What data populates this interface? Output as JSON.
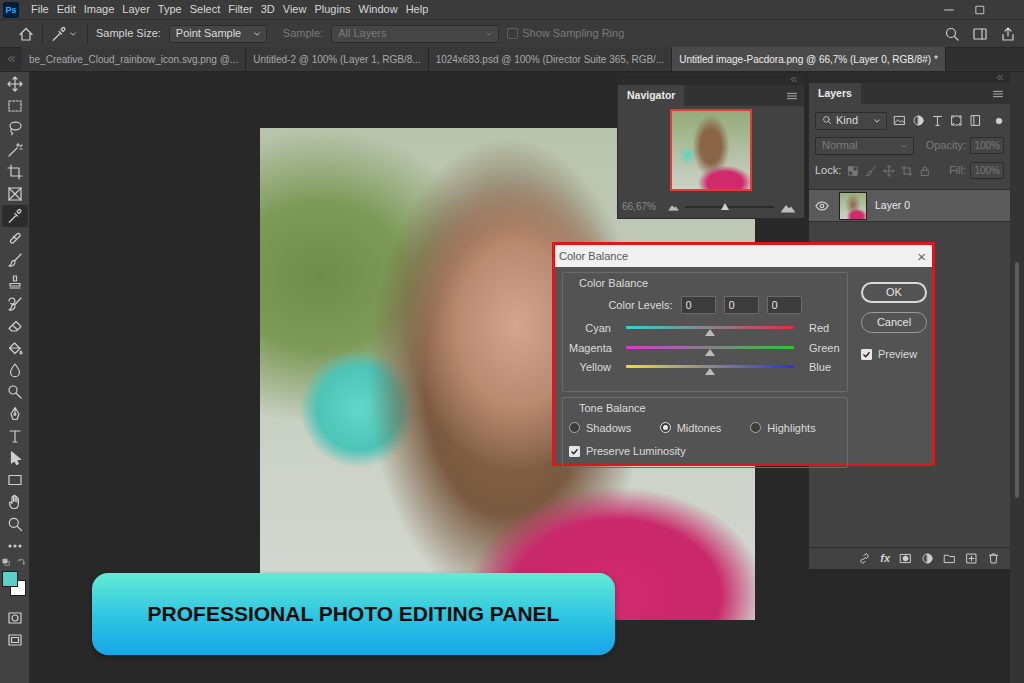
{
  "app": {
    "logo": "Ps"
  },
  "menu": [
    "File",
    "Edit",
    "Image",
    "Layer",
    "Type",
    "Select",
    "Filter",
    "3D",
    "View",
    "Plugins",
    "Window",
    "Help"
  ],
  "options_bar": {
    "sample_size_label": "Sample Size:",
    "sample_size": "Point Sample",
    "sample_label": "Sample:",
    "sample": "All Layers",
    "sample_disabled": true,
    "sampling_ring": {
      "label": "Show Sampling Ring",
      "checked": false,
      "disabled": true
    }
  },
  "tabs": [
    {
      "label": "be_Creative_Cloud_rainbow_icon.svg.png @...",
      "selected": false
    },
    {
      "label": "Untitled-2 @ 100% (Layer 1, RGB/8...",
      "selected": false
    },
    {
      "label": "1024x683.psd @ 100% (Director Suite 365, RGB/...",
      "selected": false
    },
    {
      "label": "Untitled image-Pacdora.png @ 66,7% (Layer 0, RGB/8#) *",
      "selected": true
    }
  ],
  "tools": [
    {
      "selected": false
    },
    {
      "selected": false
    },
    {
      "selected": false
    },
    {
      "selected": false
    },
    {
      "selected": false
    },
    {
      "selected": false
    },
    {
      "selected": true
    },
    {
      "selected": false
    },
    {
      "selected": false
    },
    {
      "selected": false
    },
    {
      "selected": false
    },
    {
      "selected": false
    },
    {
      "selected": false
    },
    {
      "selected": false
    },
    {
      "selected": false
    },
    {
      "selected": false
    },
    {
      "selected": false
    },
    {
      "selected": false
    },
    {
      "selected": false
    },
    {
      "selected": false
    },
    {
      "selected": false
    },
    {
      "selected": false
    }
  ],
  "swatches": [
    {
      "color": "#5ccfc6"
    },
    {
      "color": "#ffffff"
    }
  ],
  "banner": {
    "text": "PROFESSIONAL PHOTO EDITING PANEL"
  },
  "navigator": {
    "title": "Navigator",
    "zoom": "66,67%",
    "level": 0.45
  },
  "layers": {
    "title": "Layers",
    "filter": "Kind",
    "blend": {
      "value": "Normal",
      "disabled": true
    },
    "opacity": {
      "label": "Opacity:",
      "value": "100%",
      "disabled": true
    },
    "lock_label": "Lock:",
    "fill": {
      "label": "Fill:",
      "value": "100%",
      "disabled": true
    },
    "items": [
      {
        "name": "Layer 0",
        "visible": true,
        "selected": true
      }
    ],
    "fx": "fx"
  },
  "dialog": {
    "title": "Color Balance",
    "close": "×",
    "group_title": "Color Balance",
    "levels_label": "Color Levels:",
    "levels": [
      "0",
      "0",
      "0"
    ],
    "sliders": [
      {
        "left": "Cyan",
        "right": "Red",
        "level": 0.5,
        "colors": [
          "#2fd4d4",
          "#e0303a"
        ]
      },
      {
        "left": "Magenta",
        "right": "Green",
        "level": 0.5,
        "colors": [
          "#d63cd6",
          "#2ec43a"
        ]
      },
      {
        "left": "Yellow",
        "right": "Blue",
        "level": 0.5,
        "colors": [
          "#e6e23a",
          "#2f2fe0"
        ]
      }
    ],
    "tone_title": "Tone Balance",
    "tones": [
      {
        "label": "Shadows",
        "selected": false
      },
      {
        "label": "Midtones",
        "selected": true
      },
      {
        "label": "Highlights",
        "selected": false
      }
    ],
    "preserve": {
      "label": "Preserve Luminosity",
      "checked": true
    },
    "buttons": [
      {
        "label": "OK",
        "default": true
      },
      {
        "label": "Cancel",
        "default": false
      }
    ],
    "preview": {
      "label": "Preview",
      "checked": true
    }
  }
}
